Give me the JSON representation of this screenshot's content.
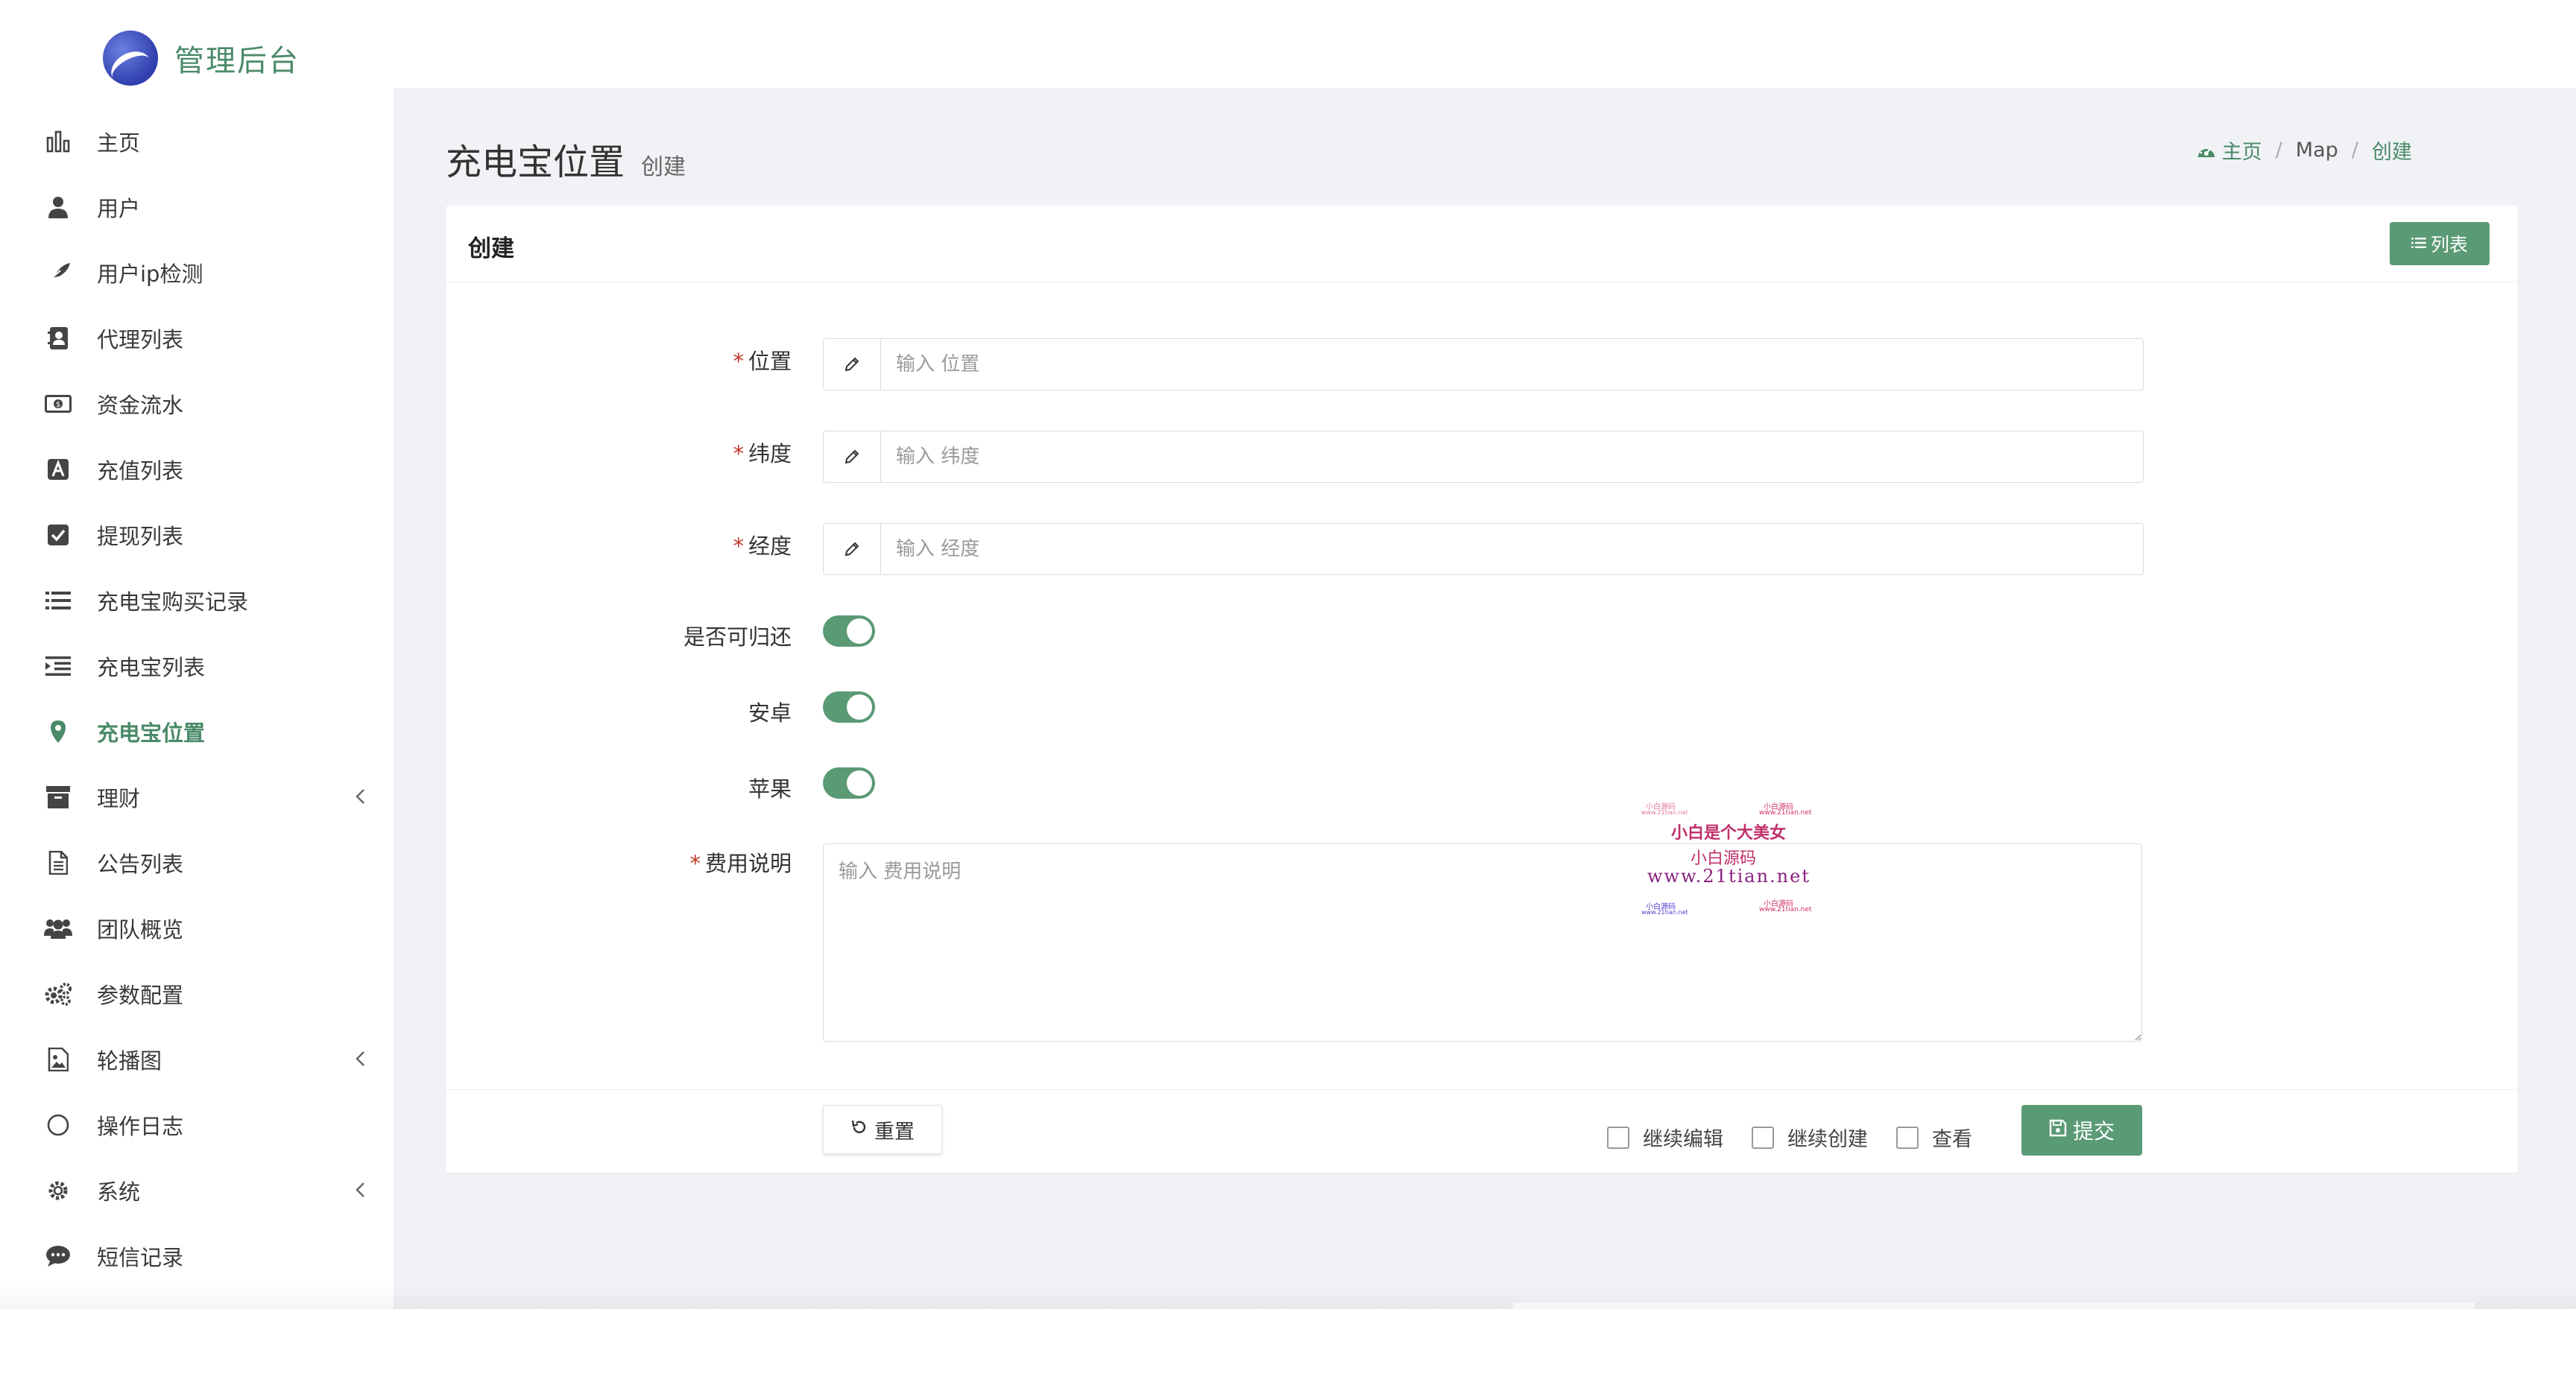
{
  "app": {
    "title": "管理后台"
  },
  "sidebar": {
    "items": [
      {
        "label": "主页",
        "icon": "bar-chart-icon",
        "caret": false,
        "active": false
      },
      {
        "label": "用户",
        "icon": "user-icon",
        "caret": false,
        "active": false
      },
      {
        "label": "用户ip检测",
        "icon": "feather-icon",
        "caret": false,
        "active": false
      },
      {
        "label": "代理列表",
        "icon": "contact-book-icon",
        "caret": false,
        "active": false
      },
      {
        "label": "资金流水",
        "icon": "money-bill-icon",
        "caret": false,
        "active": false
      },
      {
        "label": "充值列表",
        "icon": "font-a-icon",
        "caret": false,
        "active": false
      },
      {
        "label": "提现列表",
        "icon": "check-square-icon",
        "caret": false,
        "active": false
      },
      {
        "label": "充电宝购买记录",
        "icon": "list-icon",
        "caret": false,
        "active": false
      },
      {
        "label": "充电宝列表",
        "icon": "indent-icon",
        "caret": false,
        "active": false
      },
      {
        "label": "充电宝位置",
        "icon": "map-marker-icon",
        "caret": false,
        "active": true
      },
      {
        "label": "理财",
        "icon": "archive-icon",
        "caret": true,
        "active": false
      },
      {
        "label": "公告列表",
        "icon": "file-text-icon",
        "caret": false,
        "active": false
      },
      {
        "label": "团队概览",
        "icon": "users-icon",
        "caret": false,
        "active": false
      },
      {
        "label": "参数配置",
        "icon": "cogs-icon",
        "caret": false,
        "active": false
      },
      {
        "label": "轮播图",
        "icon": "image-icon",
        "caret": true,
        "active": false
      },
      {
        "label": "操作日志",
        "icon": "circle-icon",
        "caret": false,
        "active": false
      },
      {
        "label": "系统",
        "icon": "gear-icon",
        "caret": true,
        "active": false
      },
      {
        "label": "短信记录",
        "icon": "comment-icon",
        "caret": false,
        "active": false
      }
    ]
  },
  "header": {
    "title": "充电宝位置",
    "subtitle": "创建",
    "breadcrumb": [
      "主页",
      "Map",
      "创建"
    ]
  },
  "card": {
    "title": "创建",
    "list_button": "列表"
  },
  "form": {
    "location": {
      "label": "位置",
      "placeholder": "输入 位置",
      "required": true
    },
    "latitude": {
      "label": "纬度",
      "placeholder": "输入 纬度",
      "required": true
    },
    "longitude": {
      "label": "经度",
      "placeholder": "输入 经度",
      "required": true
    },
    "returnable": {
      "label": "是否可归还",
      "value": true
    },
    "android": {
      "label": "安卓",
      "value": true
    },
    "apple": {
      "label": "苹果",
      "value": true
    },
    "fee_desc": {
      "label": "费用说明",
      "placeholder": "输入 费用说明",
      "required": true
    }
  },
  "footer": {
    "reset": "重置",
    "continue_edit": "继续编辑",
    "continue_create": "继续创建",
    "view": "查看",
    "submit": "提交"
  },
  "watermark": {
    "small_a": "小白源码",
    "small_b": "www.21tian.net",
    "line1": "小白是个大美女",
    "line2": "小白源码",
    "line3": "www.21tian.net"
  },
  "colors": {
    "accent": "#5a9a75",
    "brand": "#4a8a68",
    "required": "#c0392b"
  }
}
